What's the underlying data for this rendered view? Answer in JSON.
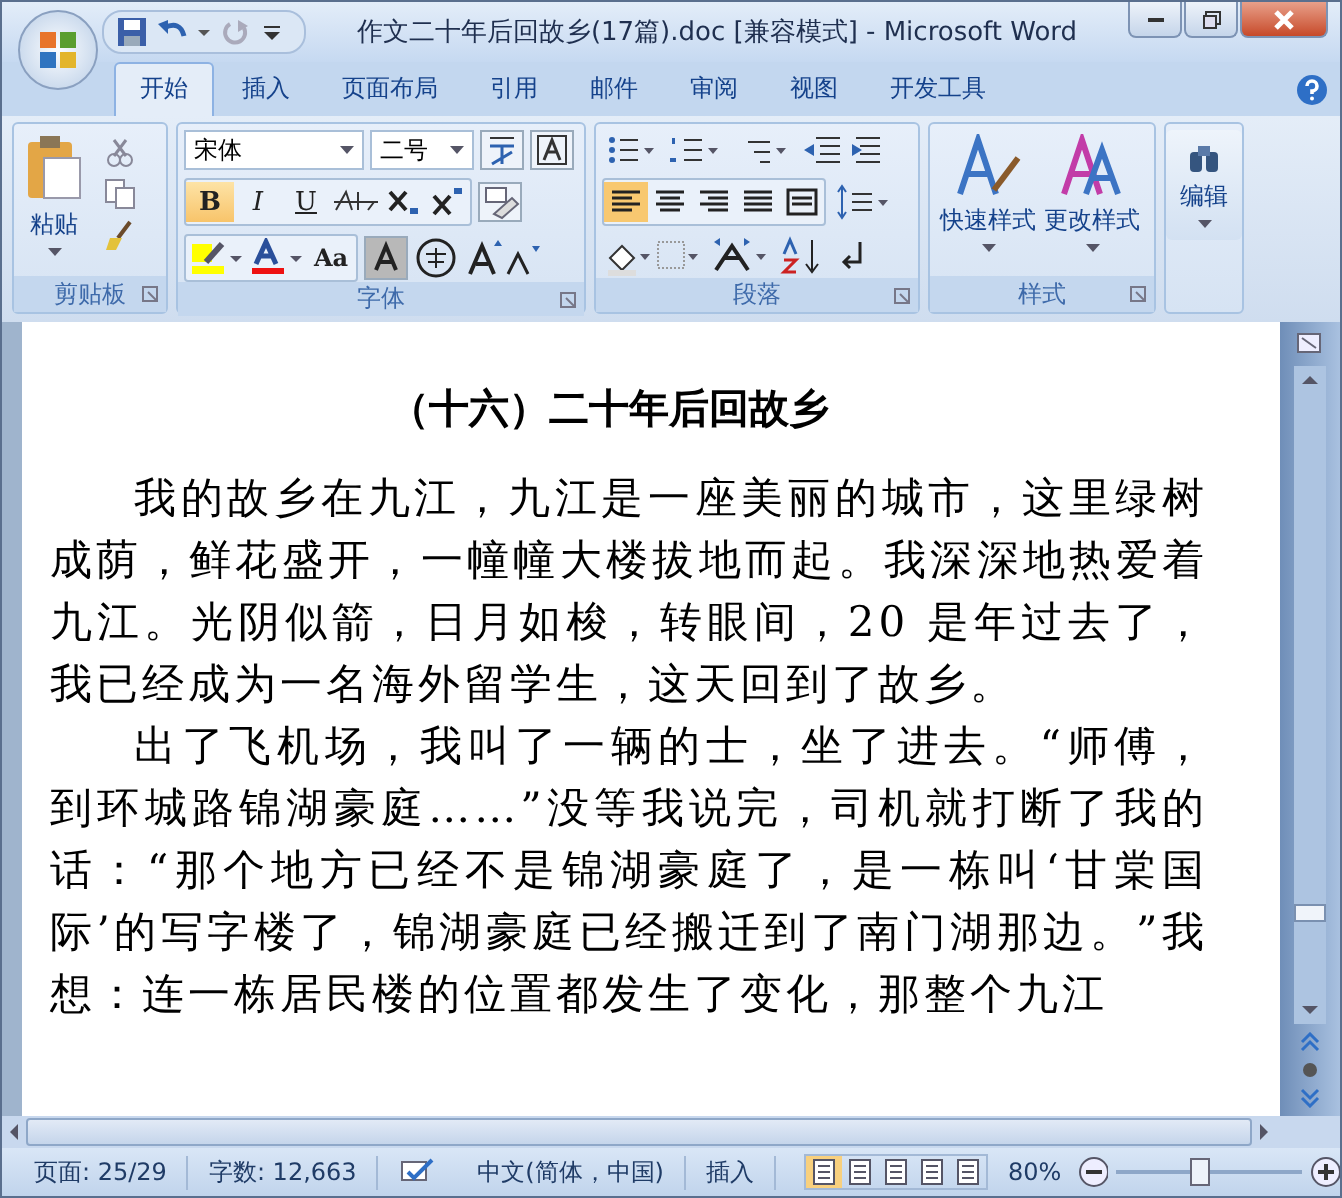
{
  "window": {
    "title": "作文二十年后回故乡(17篇).doc [兼容模式] - Microsoft Word"
  },
  "tabs": [
    {
      "label": "开始",
      "selected": true
    },
    {
      "label": "插入",
      "selected": false
    },
    {
      "label": "页面布局",
      "selected": false
    },
    {
      "label": "引用",
      "selected": false
    },
    {
      "label": "邮件",
      "selected": false
    },
    {
      "label": "审阅",
      "selected": false
    },
    {
      "label": "视图",
      "selected": false
    },
    {
      "label": "开发工具",
      "selected": false
    }
  ],
  "ribbon": {
    "clipboard": {
      "title": "剪贴板",
      "paste": "粘贴"
    },
    "font": {
      "title": "字体",
      "font_name": "宋体",
      "font_size": "二号",
      "format_buttons": [
        {
          "glyph": "B",
          "on": true
        },
        {
          "glyph": "I",
          "on": false
        },
        {
          "glyph": "U",
          "on": false
        }
      ],
      "case_glyph": "Aa"
    },
    "paragraph": {
      "title": "段落",
      "alignment": [
        {
          "selected": true
        },
        {
          "selected": false
        },
        {
          "selected": false
        },
        {
          "selected": false
        },
        {
          "selected": false
        }
      ]
    },
    "styles": {
      "title": "样式",
      "buttons": [
        "快速样式",
        "更改样式"
      ]
    },
    "editing": {
      "label": "编辑"
    }
  },
  "document": {
    "heading": "（十六）二十年后回故乡",
    "paragraphs": [
      "我的故乡在九江，九江是一座美丽的城市，这里绿树成荫，鲜花盛开，一幢幢大楼拔地而起。我深深地热爱着九江。光阴似箭，日月如梭，转眼间，20 是年过去了，我已经成为一名海外留学生，这天回到了故乡。",
      "出了飞机场，我叫了一辆的士，坐了进去。“师傅，到环城路锦湖豪庭……”没等我说完，司机就打断了我的话：“那个地方已经不是锦湖豪庭了，是一栋叫‘甘棠国际’的写字楼了，锦湖豪庭已经搬迁到了南门湖那边。”我想：连一栋居民楼的位置都发生了变化，那整个九江"
    ]
  },
  "status_bar": {
    "page": "页面: 25/29",
    "words": "字数: 12,663",
    "language": "中文(简体，中国)",
    "mode": "插入",
    "views": [
      {
        "selected": true
      },
      {
        "selected": false
      },
      {
        "selected": false
      },
      {
        "selected": false
      },
      {
        "selected": false
      }
    ],
    "zoom": "80%",
    "zoom_slider": {
      "level": 0.4
    }
  }
}
